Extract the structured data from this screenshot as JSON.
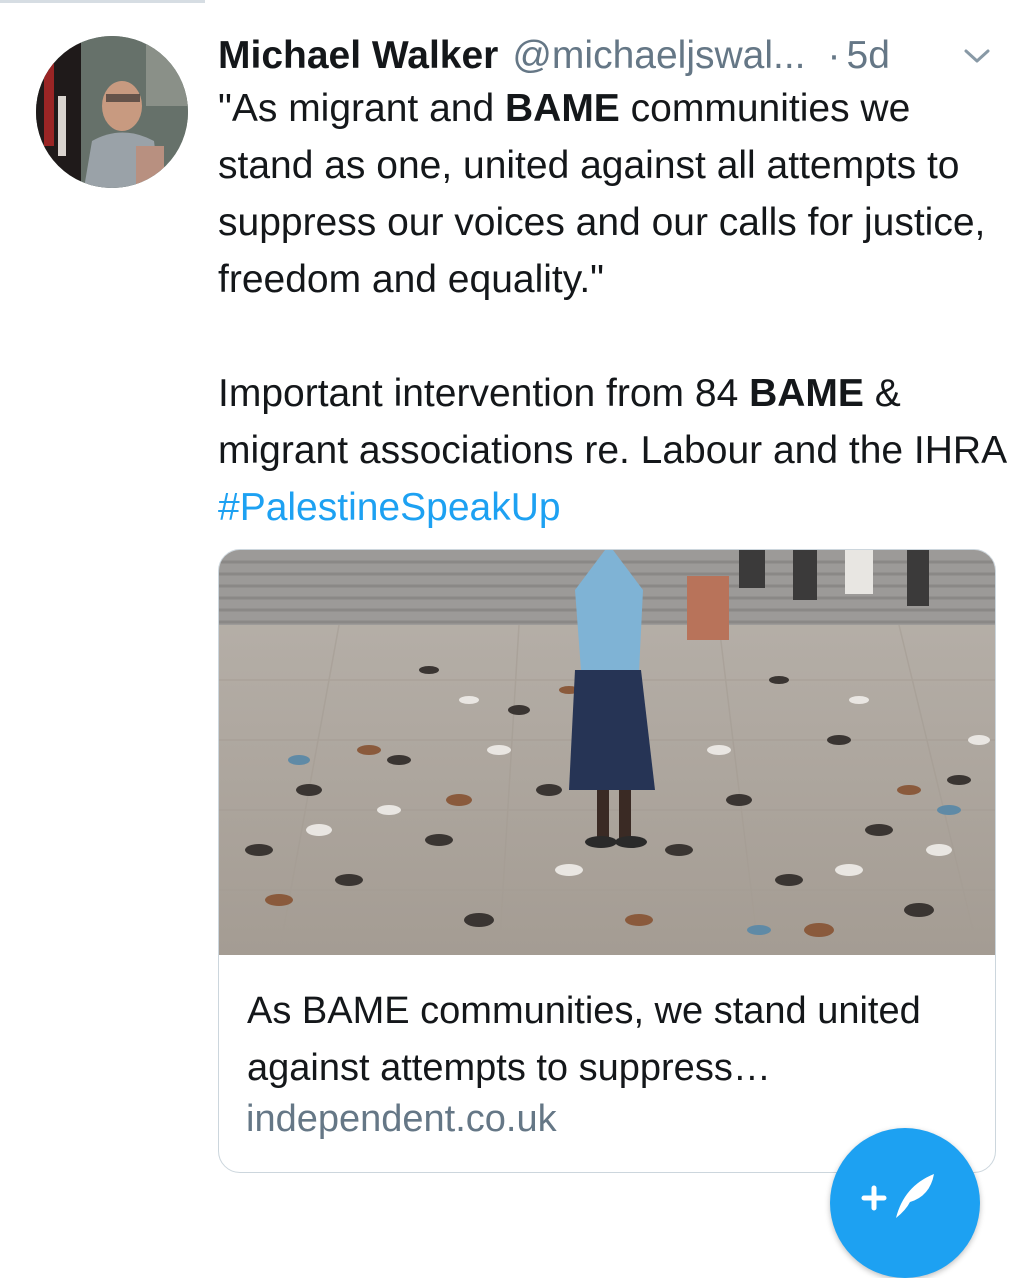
{
  "tweet": {
    "author_name": "Michael Walker",
    "author_handle": "@michaeljswal...",
    "separator": "·",
    "time": "5d",
    "text_1_a": "\"As migrant and ",
    "text_1_bold": "BAME",
    "text_1_b": " communities we stand as one, united against all attempts to suppress our voices and our calls for justice, freedom and equality.\"",
    "text_2_a": "Important intervention from 84 ",
    "text_2_bold": "BAME",
    "text_2_b": " & migrant associations re. Labour and the IHRA ",
    "hashtag": "#PalestineSpeakUp"
  },
  "card": {
    "title": "As BAME communities, we stand united against attempts to suppress…",
    "domain": "independent.co.uk"
  },
  "icons": {
    "caret": "chevron-down-icon",
    "compose": "compose-tweet-icon"
  },
  "colors": {
    "link": "#1da1f2",
    "secondary_text": "#657786",
    "border": "#ccd6dd"
  }
}
